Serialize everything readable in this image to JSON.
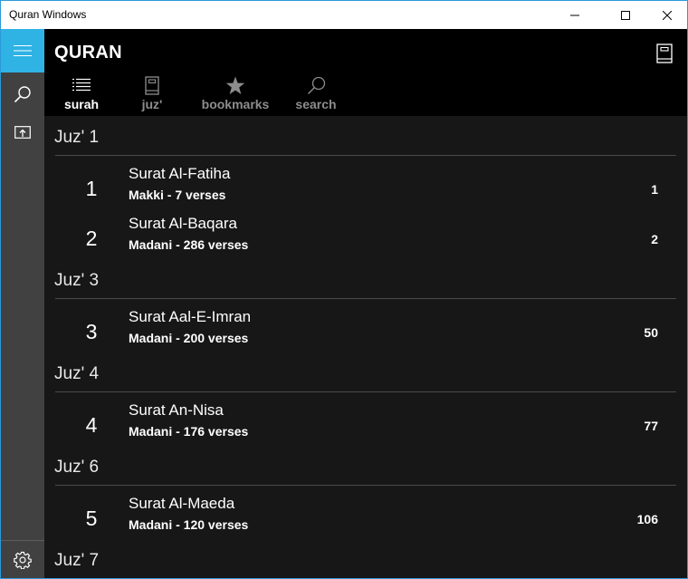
{
  "window": {
    "title": "Quran Windows",
    "controls": [
      "minimize",
      "maximize",
      "close"
    ]
  },
  "sidebar": {
    "items": [
      {
        "name": "menu",
        "icon": "hamburger-icon"
      },
      {
        "name": "search",
        "icon": "search-icon"
      },
      {
        "name": "share",
        "icon": "share-icon"
      },
      {
        "name": "settings",
        "icon": "gear-icon"
      }
    ],
    "accent_color": "#2fb3e4"
  },
  "header": {
    "title": "QURAN",
    "right_icon": "book-icon",
    "tabs": [
      {
        "label": "surah",
        "icon": "list-icon",
        "active": true
      },
      {
        "label": "juz'",
        "icon": "book-icon",
        "active": false
      },
      {
        "label": "bookmarks",
        "icon": "star-icon",
        "active": false
      },
      {
        "label": "search",
        "icon": "search-icon",
        "active": false
      }
    ]
  },
  "groups": [
    {
      "header": "Juz' 1",
      "surahs": [
        {
          "number": "1",
          "name": "Surat Al-Fatiha",
          "meta": "Makki -  7 verses",
          "page": "1"
        },
        {
          "number": "2",
          "name": "Surat Al-Baqara",
          "meta": "Madani -  286 verses",
          "page": "2"
        }
      ]
    },
    {
      "header": "Juz' 3",
      "surahs": [
        {
          "number": "3",
          "name": "Surat Aal-E-Imran",
          "meta": "Madani -  200 verses",
          "page": "50"
        }
      ]
    },
    {
      "header": "Juz' 4",
      "surahs": [
        {
          "number": "4",
          "name": "Surat An-Nisa",
          "meta": "Madani -  176 verses",
          "page": "77"
        }
      ]
    },
    {
      "header": "Juz' 6",
      "surahs": [
        {
          "number": "5",
          "name": "Surat Al-Maeda",
          "meta": "Madani -  120 verses",
          "page": "106"
        }
      ]
    },
    {
      "header": "Juz' 7",
      "surahs": []
    }
  ]
}
